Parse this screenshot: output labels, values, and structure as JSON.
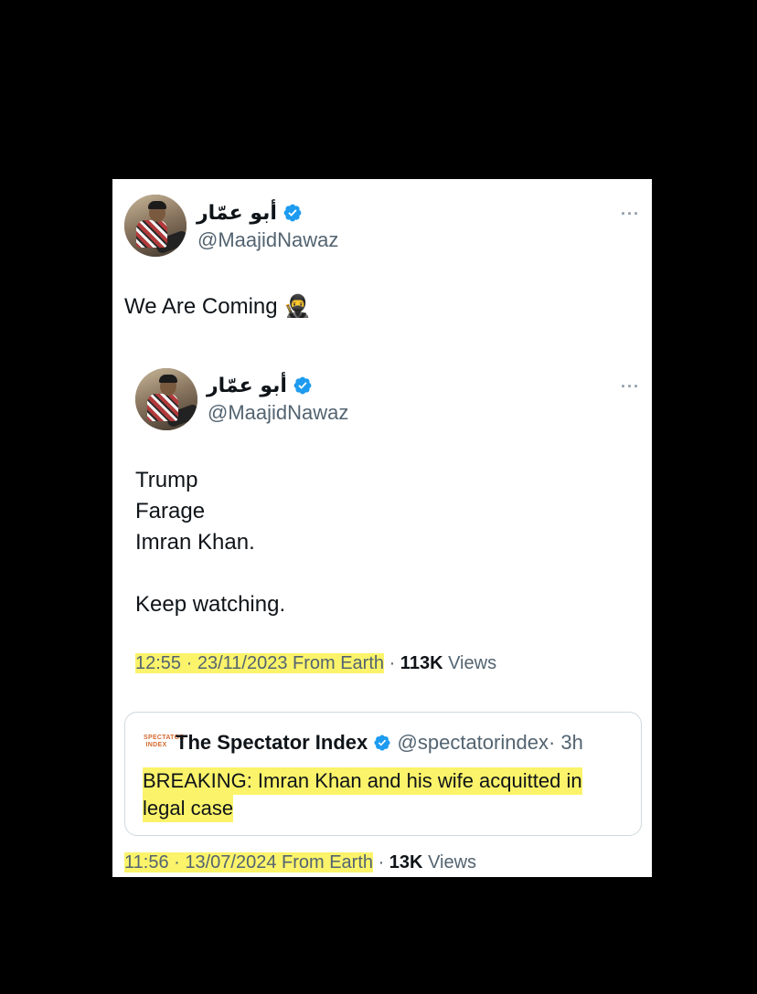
{
  "main_tweet": {
    "author_name": "أبو عمّار",
    "handle": "@MaajidNawaz",
    "text": "We Are Coming",
    "emoji": "🥷",
    "timestamp": "11:56 · 13/07/2024 From Earth",
    "views_count": "13K",
    "views_label": "Views"
  },
  "quoted_tweet": {
    "author_name": "أبو عمّار",
    "handle": "@MaajidNawaz",
    "lines": [
      "Trump",
      "Farage",
      "Imran Khan.",
      "Keep watching."
    ],
    "timestamp": "12:55 · 23/11/2023 From Earth",
    "views_count": "113K",
    "views_label": "Views"
  },
  "embedded_quote": {
    "logo_text": "SPECTATOR INDEX",
    "source_name": "The Spectator Index",
    "handle": "@spectatorindex",
    "age": "· 3h",
    "text_line1": "BREAKING: Imran Khan and his wife acquitted in",
    "text_line2": "legal case"
  },
  "more_icon": "···",
  "colors": {
    "verified_blue": "#1d9bf0",
    "highlight": "#fbf36a",
    "muted_text": "#536471",
    "background": "#000000",
    "card": "#ffffff"
  }
}
